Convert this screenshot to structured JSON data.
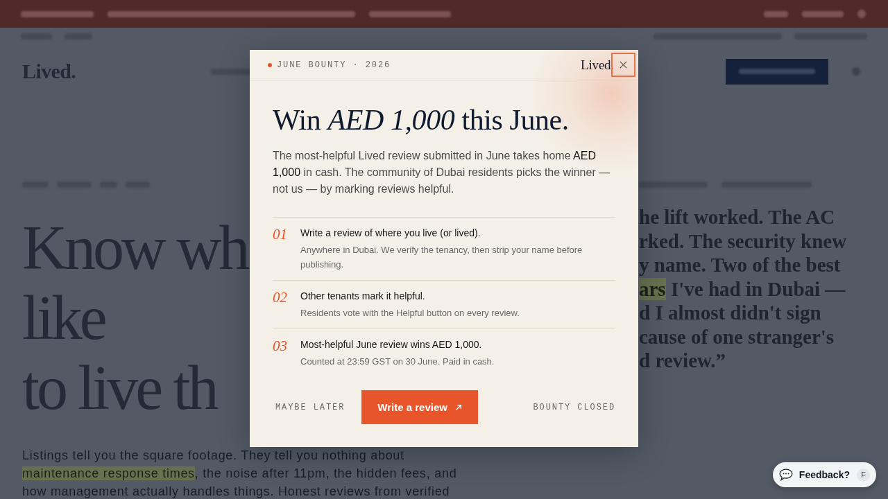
{
  "backdrop": {
    "logo": {
      "word": "Lived",
      "dot": "."
    },
    "headline_lines": [
      "Know wh",
      "like",
      "to live th"
    ],
    "body_lines": [
      {
        "kind": "plain",
        "text": "Listings tell you the square footage. They tell you nothing about"
      },
      {
        "kind": "linked",
        "link": "maintenance response times",
        "text": ", the noise after 11pm, the hidden fees, and"
      },
      {
        "kind": "plain",
        "text": "how management actually handles things. Honest reviews from verified"
      }
    ],
    "quote_lines": [
      {
        "kind": "plain",
        "text": "he lift worked. The AC"
      },
      {
        "kind": "plain",
        "text": "rked. The security knew"
      },
      {
        "kind": "plain",
        "text": "y name. Two of the best"
      },
      {
        "kind": "linked",
        "link": "ars",
        "text": " I've had in Dubai —"
      },
      {
        "kind": "plain",
        "text": "d I almost didn't sign"
      },
      {
        "kind": "plain",
        "text": "cause of one stranger's"
      },
      {
        "kind": "plain",
        "text": "d review.”"
      }
    ]
  },
  "modal": {
    "eyebrow": "JUNE BOUNTY · 2026",
    "logo": {
      "word": "Lived",
      "dot": "."
    },
    "close_button": {
      "focused": true
    },
    "title": "Win *AED 1,000* this June.",
    "intro": "The most-helpful Lived review submitted in June takes home **AED 1,000** in cash. The community of Dubai residents picks the winner — not us — by marking reviews helpful.",
    "steps": [
      {
        "number": "01",
        "title": "Write a review of where you live (or lived).",
        "text": "Anywhere in Dubai. We verify the tenancy, then strip your name before publishing."
      },
      {
        "number": "02",
        "title": "Other tenants mark it helpful.",
        "text": "Residents vote with the Helpful button on every review."
      },
      {
        "number": "03",
        "title": "Most-helpful June review wins AED 1,000.",
        "text": "Counted at 23:59 GST on 30 June. Paid in cash."
      }
    ],
    "dismiss": "MAYBE LATER",
    "cta": "Write a review",
    "status": "BOUNTY CLOSED"
  },
  "feedback_button": {
    "label": "Feedback?",
    "shortcut": "F"
  }
}
